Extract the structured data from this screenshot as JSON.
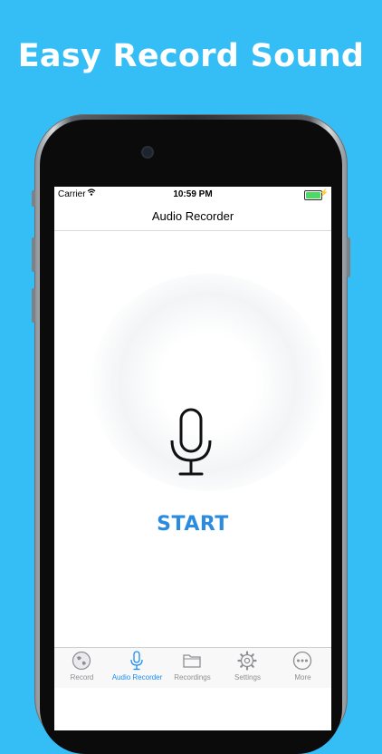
{
  "headline": "Easy Record Sound",
  "status_bar": {
    "carrier": "Carrier",
    "time": "10:59 PM"
  },
  "nav": {
    "title": "Audio Recorder"
  },
  "main": {
    "start_label": "START"
  },
  "tabs": [
    {
      "label": "Record",
      "icon": "globe-icon",
      "active": false
    },
    {
      "label": "Audio Recorder",
      "icon": "microphone-icon",
      "active": true
    },
    {
      "label": "Recordings",
      "icon": "folder-icon",
      "active": false
    },
    {
      "label": "Settings",
      "icon": "gear-icon",
      "active": false
    },
    {
      "label": "More",
      "icon": "more-icon",
      "active": false
    }
  ],
  "colors": {
    "background": "#35BDF5",
    "accent": "#2A8BE0",
    "tab_active": "#1a8ef2",
    "battery": "#4cd964"
  }
}
